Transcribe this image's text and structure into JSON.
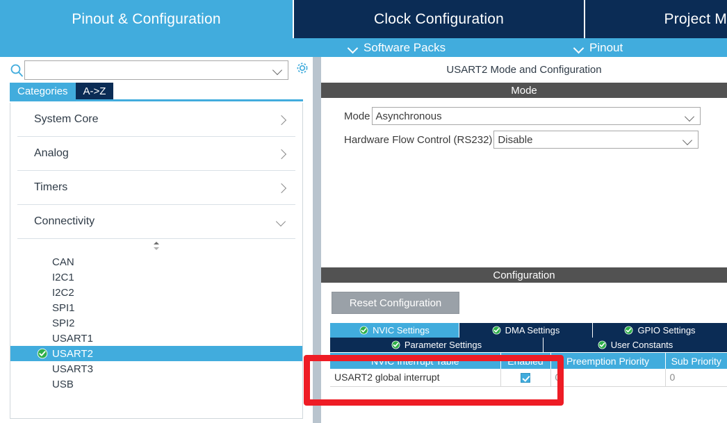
{
  "colors": {
    "accent_blue": "#41acdd",
    "dark_navy": "#0b2c55",
    "section_gray": "#525252",
    "splitter": "#b9c4ce",
    "annotation_red": "#ee1c25",
    "check_green": "#2eaf4a"
  },
  "main_tabs": [
    {
      "label": "Pinout & Configuration",
      "active": true
    },
    {
      "label": "Clock Configuration",
      "active": false
    },
    {
      "label": "Project M",
      "active": false
    }
  ],
  "sub_bar": [
    {
      "label": "Software Packs"
    },
    {
      "label": "Pinout"
    }
  ],
  "left_panel": {
    "search": {
      "value": "",
      "placeholder": ""
    },
    "gear_tooltip": "",
    "tabs": [
      {
        "label": "Categories",
        "active": true
      },
      {
        "label": "A->Z",
        "active": false
      }
    ],
    "categories": [
      {
        "label": "System Core",
        "expanded": false
      },
      {
        "label": "Analog",
        "expanded": false
      },
      {
        "label": "Timers",
        "expanded": false
      },
      {
        "label": "Connectivity",
        "expanded": true
      }
    ],
    "peripherals": [
      {
        "label": "CAN",
        "selected": false,
        "configured": false
      },
      {
        "label": "I2C1",
        "selected": false,
        "configured": false
      },
      {
        "label": "I2C2",
        "selected": false,
        "configured": false
      },
      {
        "label": "SPI1",
        "selected": false,
        "configured": false
      },
      {
        "label": "SPI2",
        "selected": false,
        "configured": false
      },
      {
        "label": "USART1",
        "selected": false,
        "configured": false
      },
      {
        "label": "USART2",
        "selected": true,
        "configured": true
      },
      {
        "label": "USART3",
        "selected": false,
        "configured": false
      },
      {
        "label": "USB",
        "selected": false,
        "configured": false
      }
    ]
  },
  "right_panel": {
    "title": "USART2 Mode and Configuration",
    "mode_section_label": "Mode",
    "mode_fields": [
      {
        "label": "Mode",
        "value": "Asynchronous"
      },
      {
        "label": "Hardware Flow Control (RS232)",
        "value": "Disable"
      }
    ],
    "config_section_label": "Configuration",
    "reset_button": "Reset Configuration",
    "config_tabs_row1": [
      {
        "label": "NVIC Settings",
        "active": true
      },
      {
        "label": "DMA Settings",
        "active": false
      },
      {
        "label": "GPIO Settings",
        "active": false
      }
    ],
    "config_tabs_row2": [
      {
        "label": "Parameter Settings",
        "active": false
      },
      {
        "label": "User Constants",
        "active": false
      }
    ],
    "nvic_table": {
      "columns": [
        "NVIC Interrupt Table",
        "Enabled",
        "Preemption Priority",
        "Sub Priority"
      ],
      "rows": [
        {
          "name": "USART2 global interrupt",
          "enabled": true,
          "preemption_priority": "0",
          "sub_priority": "0"
        }
      ]
    }
  },
  "annotation": {
    "shape": "rectangle",
    "color": "#ee1c25",
    "highlights": "NVIC Interrupt Table row for USART2 global interrupt"
  }
}
